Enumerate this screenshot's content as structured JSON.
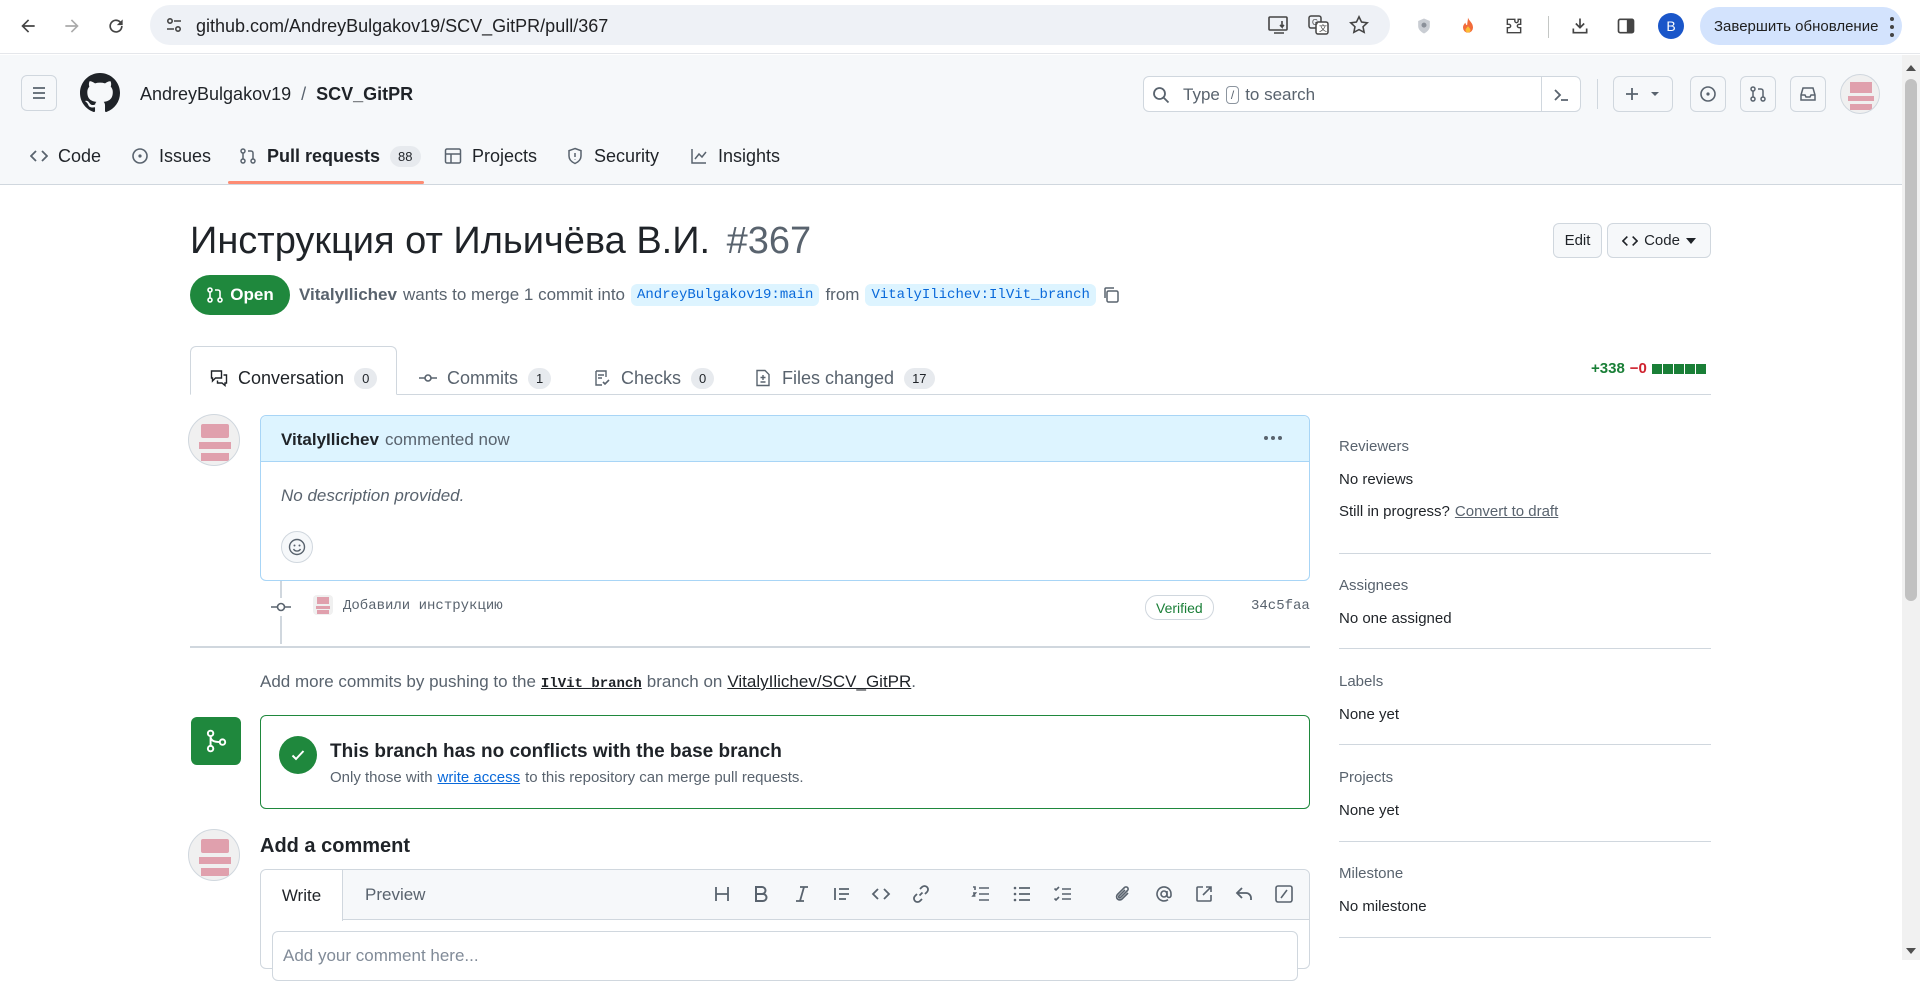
{
  "browser": {
    "url": "github.com/AndreyBulgakov19/SCV_GitPR/pull/367",
    "profile_initial": "B",
    "update_label": "Завершить обновление"
  },
  "header": {
    "owner": "AndreyBulgakov19",
    "separator": "/",
    "repo": "SCV_GitPR",
    "search_prefix": "Type",
    "search_key": "/",
    "search_suffix": "to search"
  },
  "repo_tabs": [
    {
      "label": "Code",
      "icon": "code-icon"
    },
    {
      "label": "Issues",
      "icon": "issue-icon"
    },
    {
      "label": "Pull requests",
      "icon": "pull-request-icon",
      "count": "88"
    },
    {
      "label": "Projects",
      "icon": "table-icon"
    },
    {
      "label": "Security",
      "icon": "shield-icon"
    },
    {
      "label": "Insights",
      "icon": "graph-icon"
    }
  ],
  "pr": {
    "title": "Инструкция от Ильичёва В.И.",
    "number": "#367",
    "state": "Open",
    "author": "VitalyIlichev",
    "merge_text": "wants to merge 1 commit into",
    "base": "AndreyBulgakov19:main",
    "from_text": "from",
    "head": "VitalyIlichev:IlVit_branch",
    "edit_label": "Edit",
    "code_label": "Code"
  },
  "pr_tabs": [
    {
      "label": "Conversation",
      "count": "0"
    },
    {
      "label": "Commits",
      "count": "1"
    },
    {
      "label": "Checks",
      "count": "0"
    },
    {
      "label": "Files changed",
      "count": "17"
    }
  ],
  "diffstat": {
    "added": "+338",
    "removed": "−0"
  },
  "comment": {
    "author": "VitalyIlichev",
    "meta": "commented now",
    "body": "No description provided."
  },
  "commit": {
    "message": "Добавили инструкцию",
    "badge": "Verified",
    "sha": "34c5faa"
  },
  "push_hint": {
    "prefix": "Add more commits by pushing to the",
    "branch": "IlVit_branch",
    "middle": "branch on",
    "repo": "VitalyIlichev/SCV_GitPR",
    "suffix": "."
  },
  "merge_box": {
    "title": "This branch has no conflicts with the base branch",
    "sub_prefix": "Only those with",
    "sub_link": "write access",
    "sub_suffix": "to this repository can merge pull requests."
  },
  "add_comment": {
    "title": "Add a comment",
    "write_tab": "Write",
    "preview_tab": "Preview",
    "placeholder": "Add your comment here..."
  },
  "sidebar": {
    "reviewers": {
      "title": "Reviewers",
      "value": "No reviews",
      "progress": "Still in progress?",
      "link": "Convert to draft"
    },
    "assignees": {
      "title": "Assignees",
      "value": "No one assigned"
    },
    "labels": {
      "title": "Labels",
      "value": "None yet"
    },
    "projects": {
      "title": "Projects",
      "value": "None yet"
    },
    "milestone": {
      "title": "Milestone",
      "value": "No milestone"
    }
  },
  "colors": {
    "open_green": "#1f883d",
    "accent_blue": "#0969da",
    "tab_underline": "#fd8c73"
  }
}
